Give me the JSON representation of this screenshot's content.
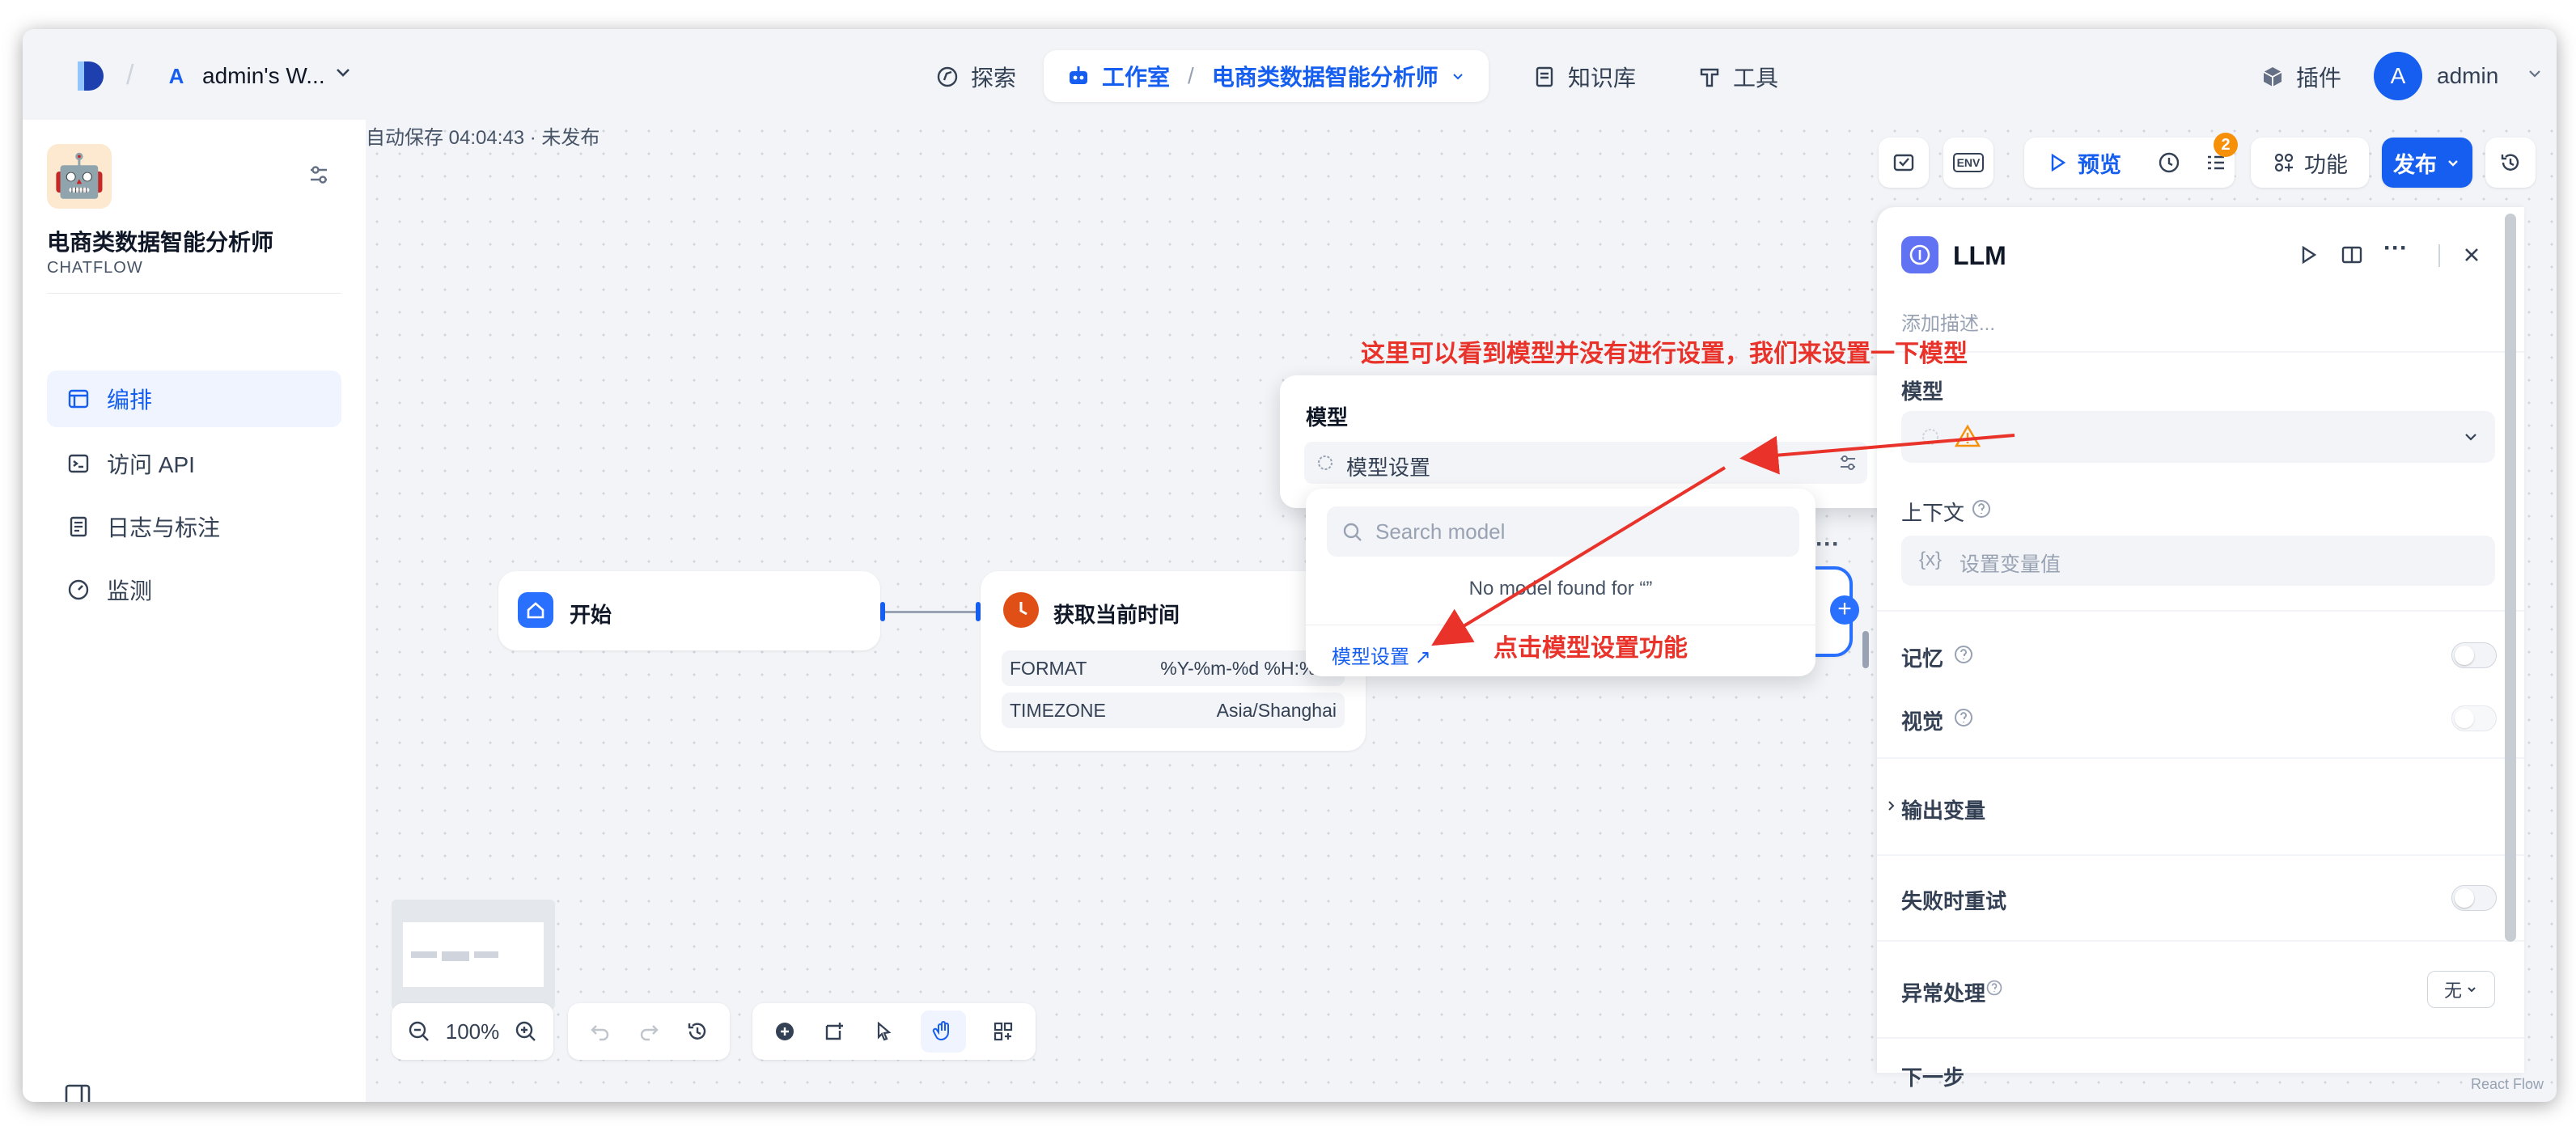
{
  "workspace": {
    "letter": "A",
    "name": "admin's W..."
  },
  "nav": {
    "explore": "探索",
    "studio": "工作室",
    "app_name": "电商类数据智能分析师",
    "knowledge": "知识库",
    "tools": "工具",
    "plugins": "插件",
    "user_initial": "A",
    "user_name": "admin"
  },
  "app": {
    "title": "电商类数据智能分析师",
    "type": "CHATFLOW",
    "icon": "🤖"
  },
  "sidebar": {
    "items": [
      {
        "label": "编排",
        "icon": "layout-icon"
      },
      {
        "label": "访问 API",
        "icon": "terminal-icon"
      },
      {
        "label": "日志与标注",
        "icon": "log-icon"
      },
      {
        "label": "监测",
        "icon": "gauge-icon"
      }
    ]
  },
  "canvas": {
    "autosave": "自动保存 04:04:43 · 未发布",
    "start_node": "开始",
    "time_node": {
      "title": "获取当前时间",
      "rows": [
        {
          "key": "FORMAT",
          "value": "%Y-%m-%d %H:%M:"
        },
        {
          "key": "TIMEZONE",
          "value": "Asia/Shanghai"
        }
      ]
    },
    "zoom": "100%"
  },
  "toolbar": {
    "env": "ENV",
    "preview": "预览",
    "badge": "2",
    "features": "功能",
    "publish": "发布"
  },
  "panel": {
    "title": "LLM",
    "desc_placeholder": "添加描述...",
    "model_label": "模型",
    "context_label": "上下文",
    "context_placeholder": "设置变量值",
    "var_symbol": "{x}",
    "memory_label": "记忆",
    "vision_label": "视觉",
    "output_label": "输出变量",
    "retry_label": "失败时重试",
    "error_label": "异常处理",
    "error_value": "无",
    "next_label": "下一步"
  },
  "popover": {
    "title": "模型",
    "model_settings": "模型设置",
    "search_placeholder": "Search model",
    "empty_text": "No model found for “”",
    "settings_link": "模型设置 ↗"
  },
  "annotations": {
    "top": "这里可以看到模型并没有进行设置，我们来设置一下模型",
    "bottom": "点击模型设置功能",
    "color": "#e8322a"
  },
  "watermark": "React Flow"
}
